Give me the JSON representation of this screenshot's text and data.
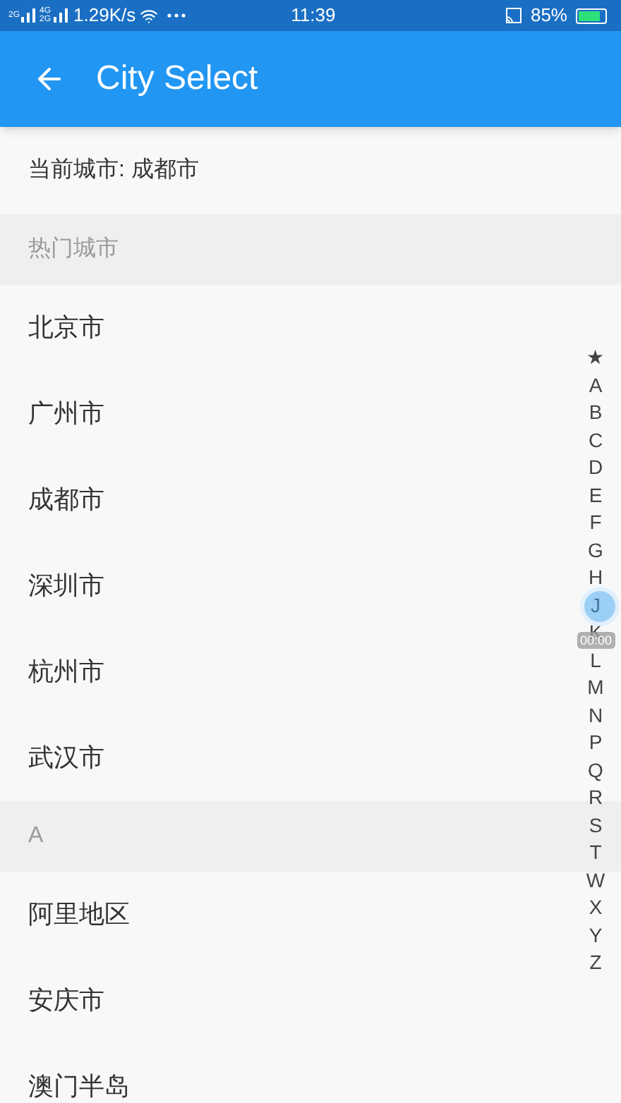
{
  "status_bar": {
    "sim_labels": [
      "2G",
      "4G",
      "2G"
    ],
    "speed": "1.29K/s",
    "time": "11:39",
    "battery": "85%"
  },
  "toolbar": {
    "title": "City Select"
  },
  "current_city": "当前城市: 成都市",
  "sections": [
    {
      "header": "热门城市",
      "cities": [
        "北京市",
        "广州市",
        "成都市",
        "深圳市",
        "杭州市",
        "武汉市"
      ]
    },
    {
      "header": "A",
      "cities": [
        "阿里地区",
        "安庆市",
        "澳门半岛"
      ]
    }
  ],
  "index": [
    "★",
    "A",
    "B",
    "C",
    "D",
    "E",
    "F",
    "G",
    "H",
    "J",
    "K",
    "L",
    "M",
    "N",
    "P",
    "Q",
    "R",
    "S",
    "T",
    "W",
    "X",
    "Y",
    "Z"
  ],
  "recorder": {
    "time": "00:00"
  }
}
